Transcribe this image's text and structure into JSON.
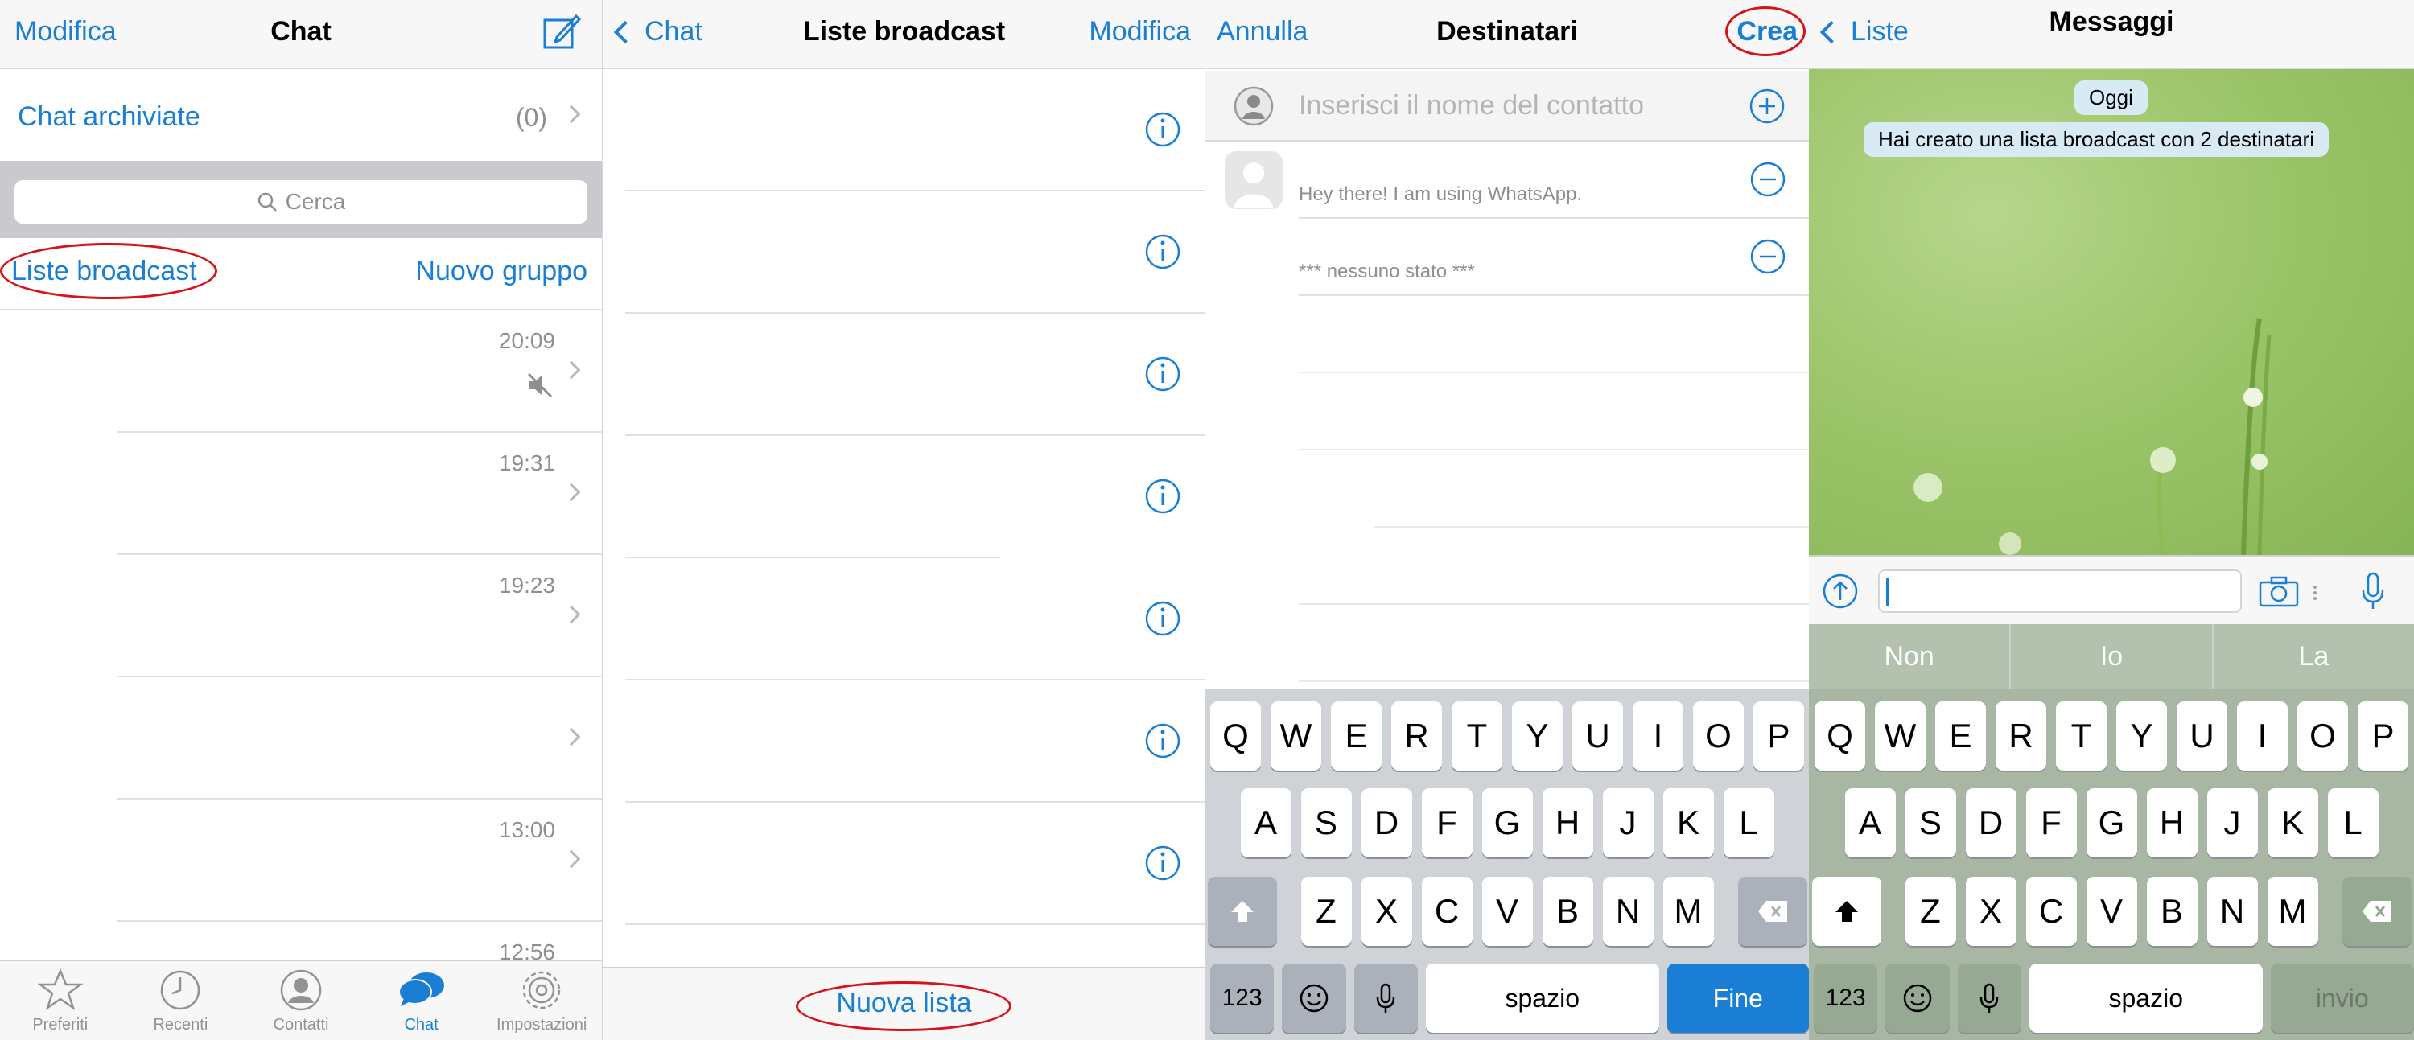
{
  "panel1": {
    "nav": {
      "left": "Modifica",
      "title": "Chat"
    },
    "archived": {
      "label": "Chat archiviate",
      "count": "(0)"
    },
    "search": {
      "placeholder": "Cerca"
    },
    "links": {
      "broadcast": "Liste broadcast",
      "new_group": "Nuovo gruppo"
    },
    "chats": [
      {
        "time": "20:09",
        "muted": true
      },
      {
        "time": "19:31"
      },
      {
        "time": "19:23"
      },
      {
        "time": ""
      },
      {
        "time": "13:00"
      },
      {
        "time": "12:56"
      }
    ],
    "tabs": [
      {
        "label": "Preferiti",
        "icon": "star-icon"
      },
      {
        "label": "Recenti",
        "icon": "clock-icon"
      },
      {
        "label": "Contatti",
        "icon": "contact-icon"
      },
      {
        "label": "Chat",
        "icon": "chat-bubbles-icon",
        "active": true
      },
      {
        "label": "Impostazioni",
        "icon": "gear-icon"
      }
    ]
  },
  "panel2": {
    "nav": {
      "back": "Chat",
      "title": "Liste broadcast",
      "right": "Modifica"
    },
    "rows": 7,
    "bottom": {
      "new_list": "Nuova lista"
    }
  },
  "panel3": {
    "nav": {
      "left": "Annulla",
      "title": "Destinatari",
      "right": "Crea"
    },
    "input": {
      "placeholder": "Inserisci il nome del contatto"
    },
    "contacts": [
      {
        "status": "Hey there! I am using WhatsApp."
      },
      {
        "status": "*** nessuno stato ***"
      }
    ],
    "keyboard": {
      "row1": [
        "Q",
        "W",
        "E",
        "R",
        "T",
        "Y",
        "U",
        "I",
        "O",
        "P"
      ],
      "row2": [
        "A",
        "S",
        "D",
        "F",
        "G",
        "H",
        "J",
        "K",
        "L"
      ],
      "row3": [
        "Z",
        "X",
        "C",
        "V",
        "B",
        "N",
        "M"
      ],
      "num": "123",
      "space": "spazio",
      "action": "Fine"
    }
  },
  "panel4": {
    "nav": {
      "back": "Liste",
      "title": "Messaggi"
    },
    "date_pill": "Oggi",
    "system_msg": "Hai creato una lista broadcast con 2 destinatari",
    "suggestions": [
      "Non",
      "Io",
      "La"
    ],
    "keyboard": {
      "row1": [
        "Q",
        "W",
        "E",
        "R",
        "T",
        "Y",
        "U",
        "I",
        "O",
        "P"
      ],
      "row2": [
        "A",
        "S",
        "D",
        "F",
        "G",
        "H",
        "J",
        "K",
        "L"
      ],
      "row3": [
        "Z",
        "X",
        "C",
        "V",
        "B",
        "N",
        "M"
      ],
      "num": "123",
      "space": "spazio",
      "action": "invio"
    }
  },
  "colors": {
    "accent": "#1a7fd4",
    "highlight_oval": "#d4141a"
  }
}
